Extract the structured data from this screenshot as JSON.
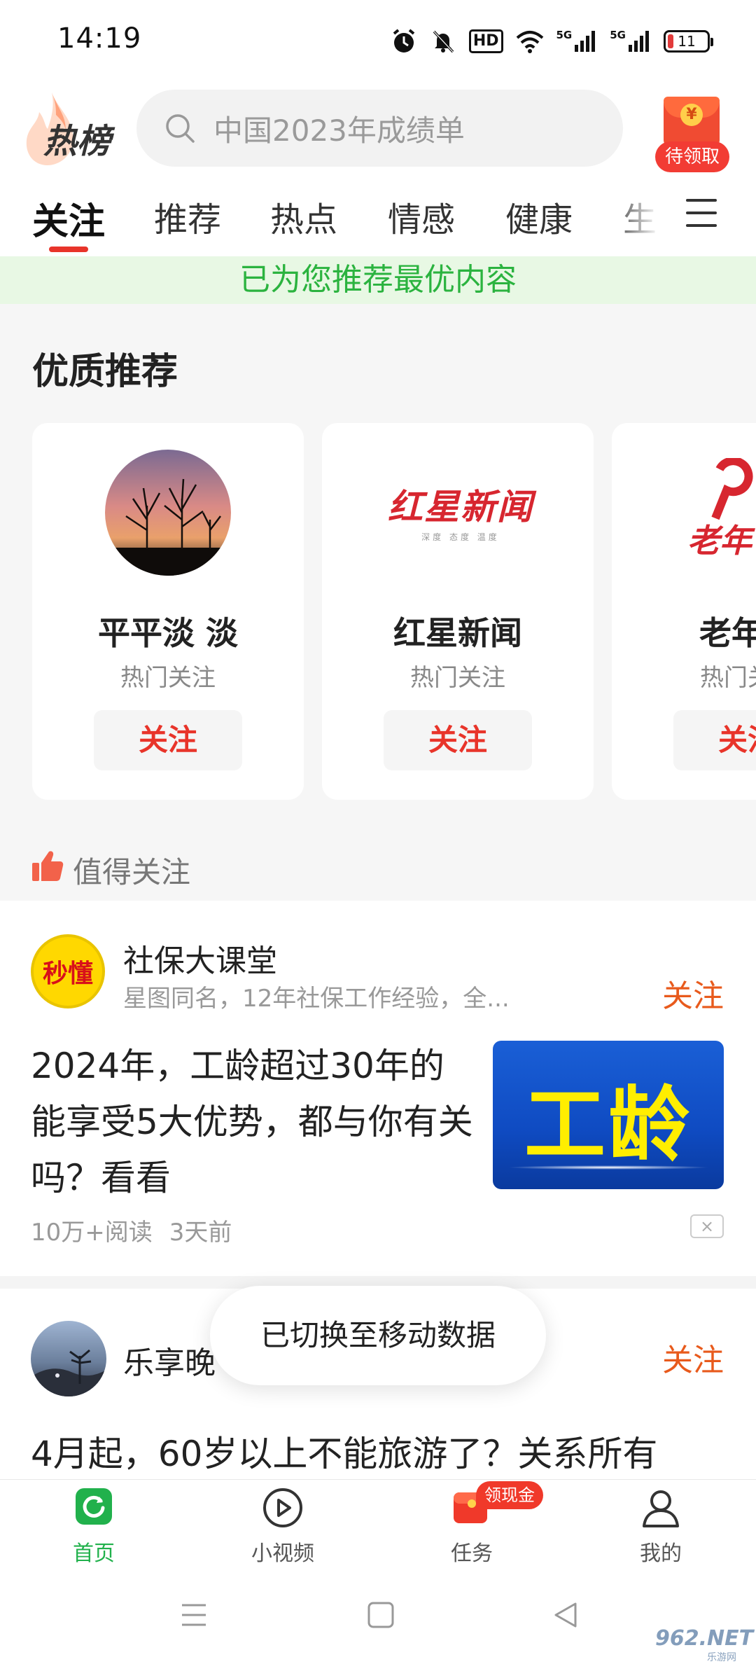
{
  "status_bar": {
    "time": "14:19",
    "hd_label": "HD",
    "signal_1_label": "5G",
    "signal_2_label": "5G",
    "battery": "11"
  },
  "header": {
    "logo_text": "热榜",
    "search_placeholder": "中国2023年成绩单",
    "redpack_label": "待领取",
    "redpack_coin": "¥"
  },
  "tabs": [
    {
      "label": "关注",
      "active": true
    },
    {
      "label": "推荐"
    },
    {
      "label": "热点"
    },
    {
      "label": "情感"
    },
    {
      "label": "健康"
    },
    {
      "label": "生"
    }
  ],
  "banner": "已为您推荐最优内容",
  "quality": {
    "title": "优质推荐",
    "cards": [
      {
        "name": "平平淡 淡",
        "sub": "热门关注",
        "follow": "关注",
        "avatar_icon": "sunset-tree-avatar"
      },
      {
        "name": "红星新闻",
        "sub": "热门关注",
        "follow": "关注",
        "logo_text": "红星新闻",
        "logo_tagline": "深度 态度 温度"
      },
      {
        "name": "老年日",
        "sub": "热门关注",
        "follow": "关注",
        "logo_text": "老年"
      }
    ]
  },
  "worth": {
    "label": "值得关注",
    "icon": "thumb-up-icon"
  },
  "feed": [
    {
      "author": "社保大课堂",
      "avatar_text": "秒懂",
      "desc": "星图同名，12年社保工作经验，全...",
      "follow": "关注",
      "title": "2024年，工龄超过30年的能享受5大优势，都与你有关吗？看看",
      "thumb_text": "工龄",
      "reads": "10万+阅读",
      "time": "3天前",
      "close": "×"
    },
    {
      "author": "乐享晚",
      "follow": "关注",
      "title": "4月起，60岁以上不能旅游了？关系所有"
    }
  ],
  "toast": "已切换至移动数据",
  "bottom_nav": [
    {
      "label": "首页",
      "icon": "home-refresh-icon",
      "active": true
    },
    {
      "label": "小视频",
      "icon": "play-circle-icon"
    },
    {
      "label": "任务",
      "icon": "task-wallet-icon",
      "badge": "领现金"
    },
    {
      "label": "我的",
      "icon": "person-icon"
    }
  ],
  "watermark": "962.NET",
  "watermark_sub": "乐游网",
  "colors": {
    "accent_red": "#e8342a",
    "follow_orange": "#e85a1c",
    "banner_green": "#2bb33f",
    "nav_active_green": "#21b14c"
  }
}
